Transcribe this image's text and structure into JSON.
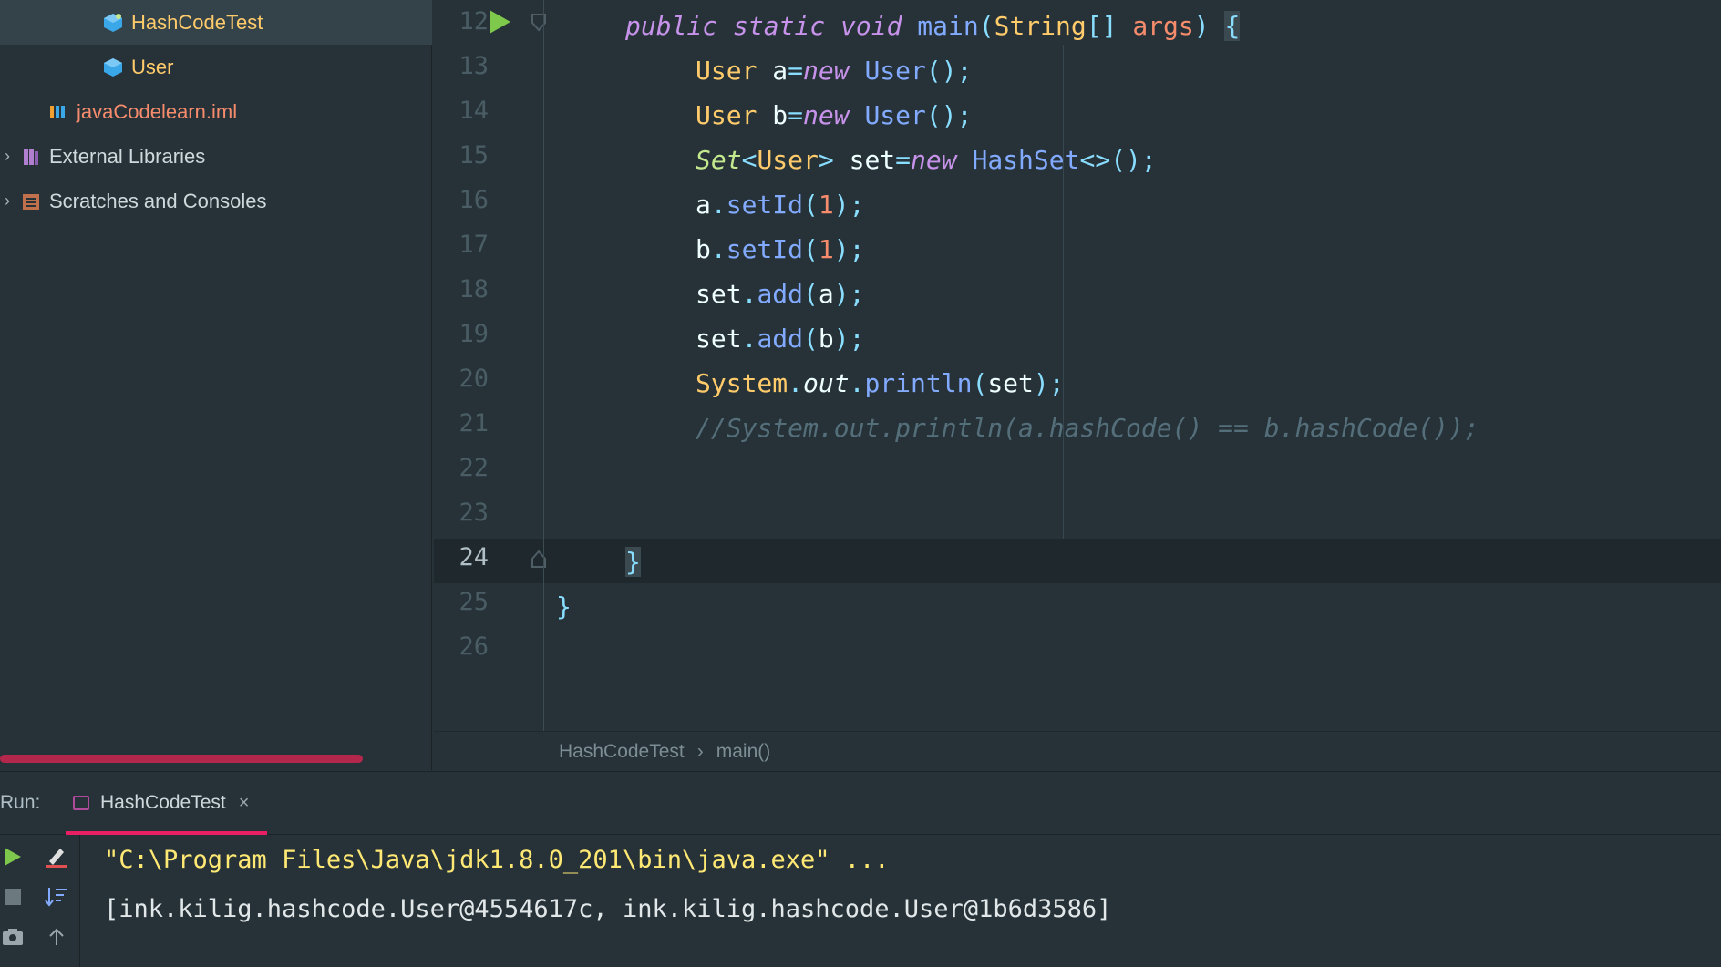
{
  "project_tree": {
    "items": [
      {
        "label": "HashCodeTest",
        "icon": "java-class-icon",
        "color": "#ffcb6b",
        "selected": true
      },
      {
        "label": "User",
        "icon": "java-class-icon",
        "color": "#ffcb6b",
        "selected": false
      },
      {
        "label": "javaCodelearn.iml",
        "icon": "iml-file-icon",
        "color": "#f78c6c",
        "selected": false
      },
      {
        "label": "External Libraries",
        "icon": "library-icon",
        "color": "#cfd8dc",
        "selected": false
      },
      {
        "label": "Scratches and Consoles",
        "icon": "scratches-icon",
        "color": "#cfd8dc",
        "selected": false
      }
    ]
  },
  "editor": {
    "line_numbers": [
      "12",
      "13",
      "14",
      "15",
      "16",
      "17",
      "18",
      "19",
      "20",
      "21",
      "22",
      "23",
      "24",
      "25",
      "26"
    ],
    "current_line": "24"
  },
  "breadcrumb": {
    "items": [
      "HashCodeTest",
      "main()"
    ],
    "separator": "›"
  },
  "run_panel": {
    "label": "Run:",
    "tab_label": "HashCodeTest",
    "close_glyph": "×",
    "console_lines": [
      "\"C:\\Program Files\\Java\\jdk1.8.0_201\\bin\\java.exe\" ...",
      "[ink.kilig.hashcode.User@4554617c, ink.kilig.hashcode.User@1b6d3586]"
    ]
  }
}
